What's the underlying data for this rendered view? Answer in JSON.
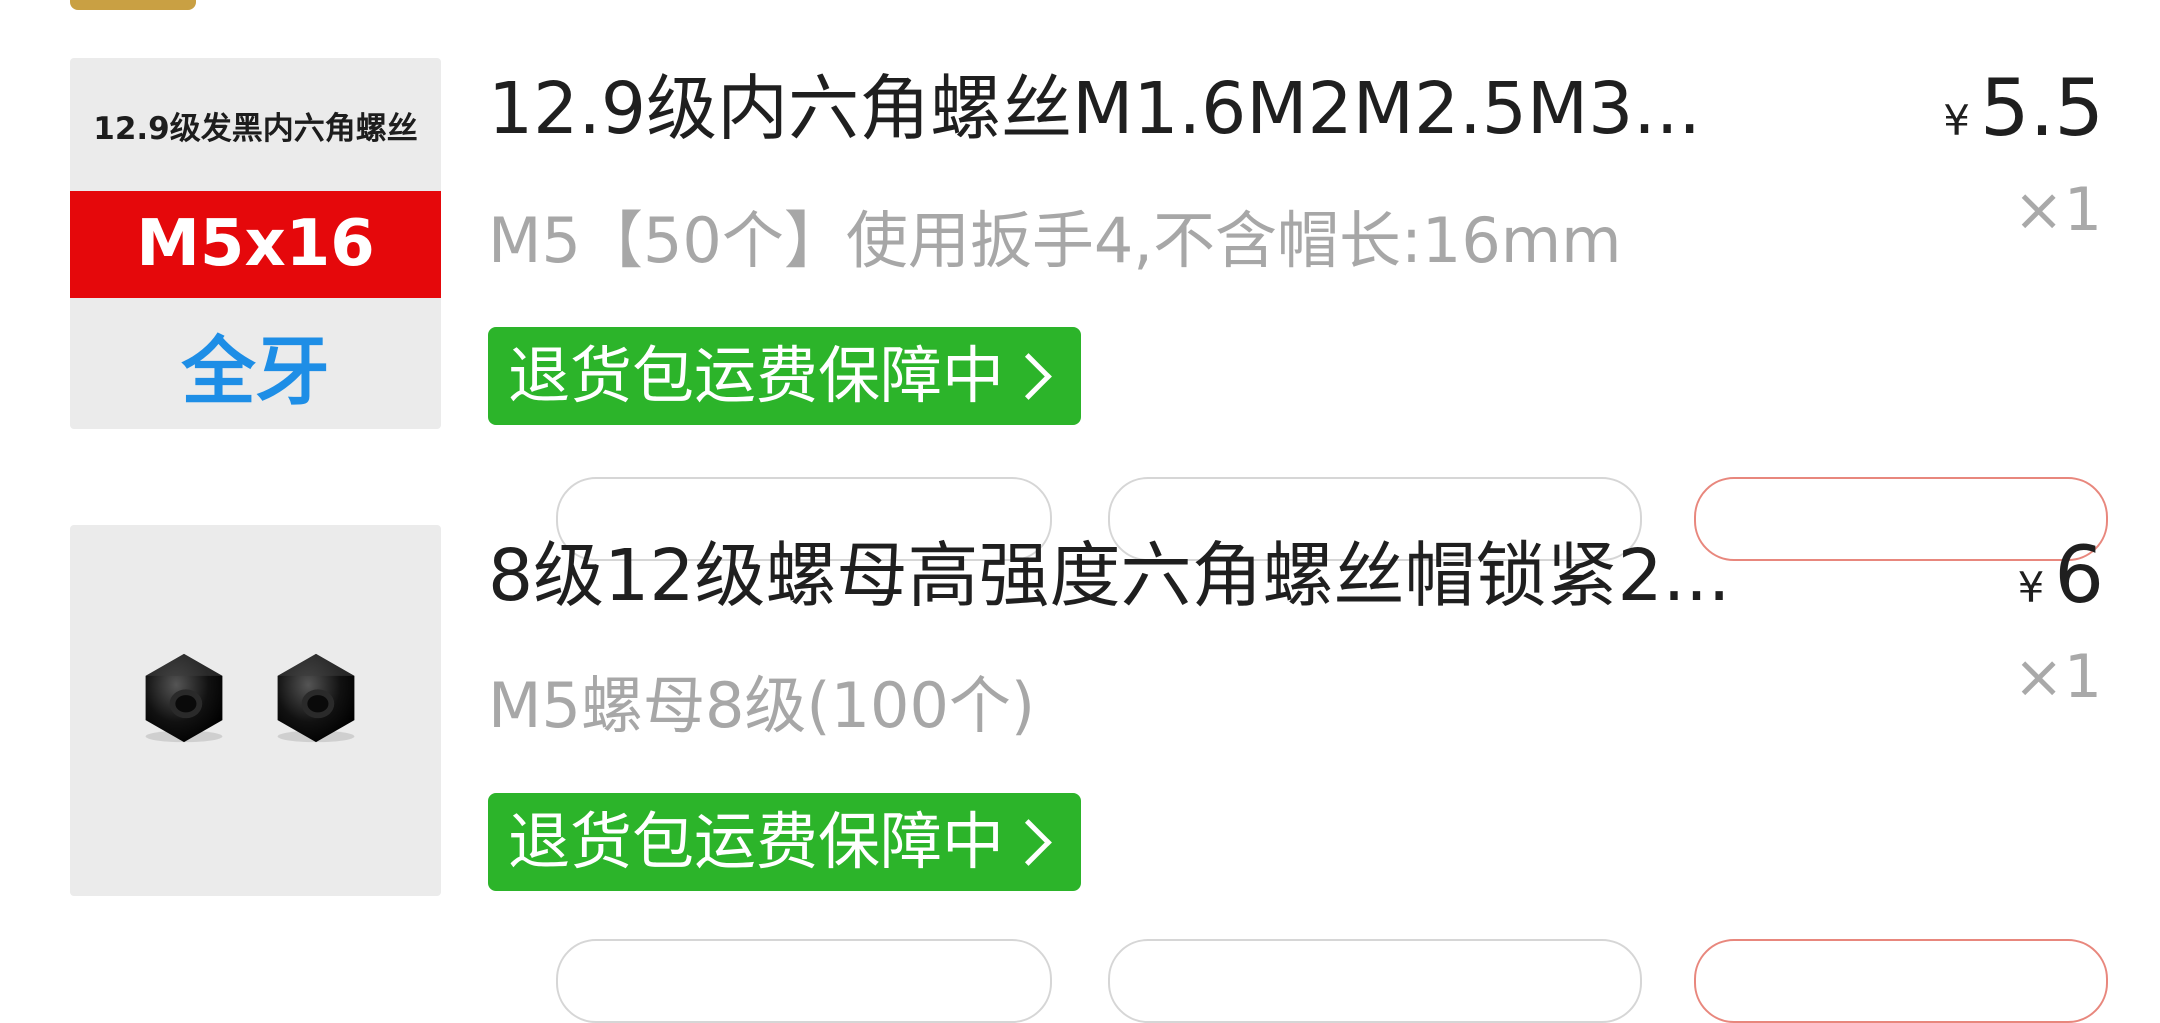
{
  "items": [
    {
      "title": "12.9级内六角螺丝M1.6M2M2.5M3...",
      "spec": "M5【50个】使用扳手4,不含帽长:16mm",
      "guarantee": "退货包运费保障中",
      "currency": "¥",
      "price": "5.5",
      "quantity": "×1",
      "thumbnail": {
        "caption": "12.9级发黑内六角螺丝",
        "size_label": "M5x16",
        "thread_label": "全牙"
      }
    },
    {
      "title": "8级12级螺母高强度六角螺丝帽锁紧2...",
      "spec": "M5螺母8级(100个)",
      "guarantee": "退货包运费保障中",
      "currency": "¥",
      "price": "6",
      "quantity": "×1"
    }
  ],
  "colors": {
    "guarantee_green": "#2cb42a",
    "thumb_red_band": "#e5080b",
    "thumb_blue_text": "#1e8ee6",
    "spec_gray": "#a7a7a7"
  }
}
